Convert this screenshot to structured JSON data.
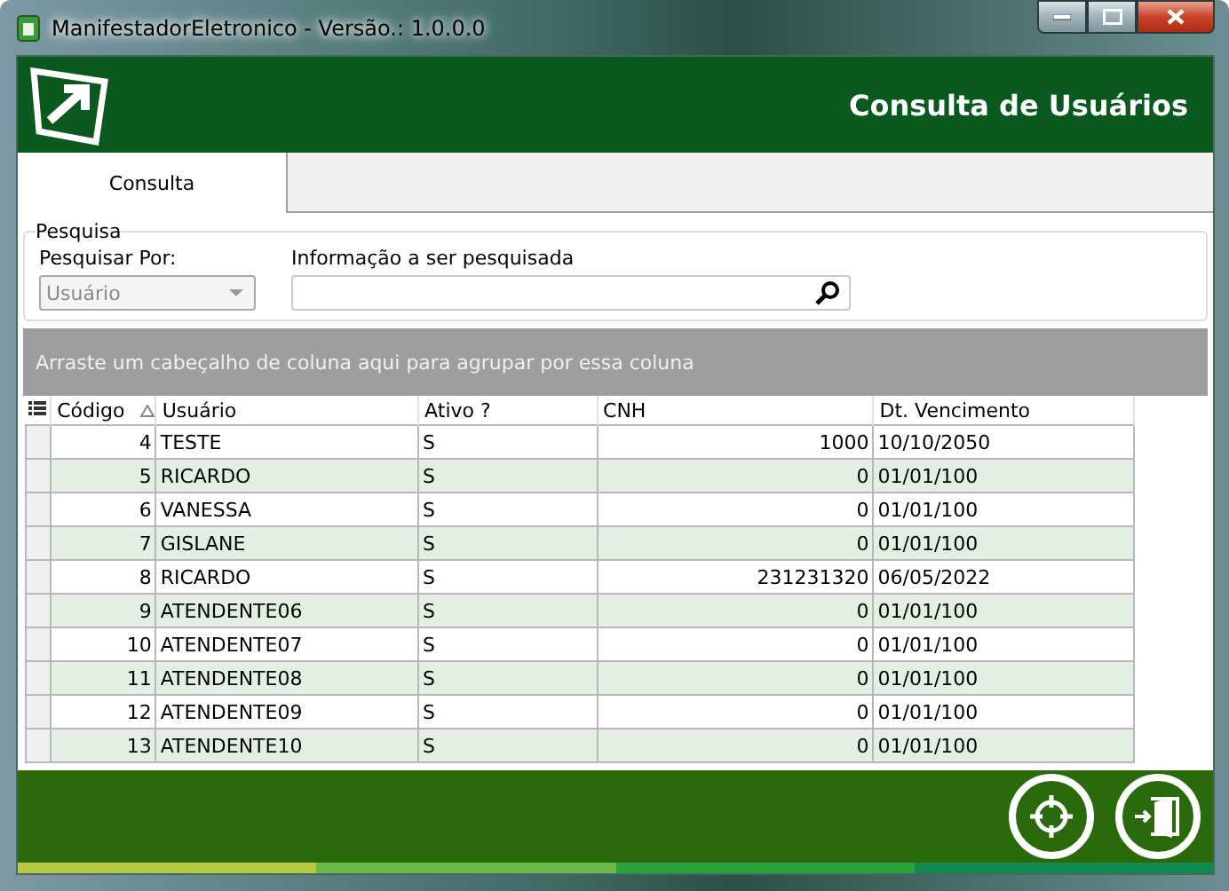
{
  "window": {
    "title": "ManifestadorEletronico - Versão.: 1.0.0.0"
  },
  "header": {
    "title": "Consulta de Usuários"
  },
  "tabs": [
    {
      "label": "Consulta",
      "selected": true
    }
  ],
  "search": {
    "group_title": "Pesquisa",
    "by_label": "Pesquisar Por:",
    "by_value": "Usuário",
    "by_disabled": true,
    "info_label": "Informação a ser pesquisada"
  },
  "group_panel": "Arraste um cabeçalho de coluna aqui para agrupar por essa coluna",
  "table": {
    "columns": [
      "Código",
      "Usuário",
      "Ativo ?",
      "CNH",
      "Dt. Vencimento"
    ],
    "rows": [
      [
        "4",
        "TESTE",
        "S",
        "1000",
        "10/10/2050"
      ],
      [
        "5",
        "RICARDO",
        "S",
        "0",
        "01/01/100"
      ],
      [
        "6",
        "VANESSA",
        "S",
        "0",
        "01/01/100"
      ],
      [
        "7",
        "GISLANE",
        "S",
        "0",
        "01/01/100"
      ],
      [
        "8",
        "RICARDO",
        "S",
        "231231320",
        "06/05/2022"
      ],
      [
        "9",
        "ATENDENTE06",
        "S",
        "0",
        "01/01/100"
      ],
      [
        "10",
        "ATENDENTE07",
        "S",
        "0",
        "01/01/100"
      ],
      [
        "11",
        "ATENDENTE08",
        "S",
        "0",
        "01/01/100"
      ],
      [
        "12",
        "ATENDENTE09",
        "S",
        "0",
        "01/01/100"
      ],
      [
        "13",
        "ATENDENTE10",
        "S",
        "0",
        "01/01/100"
      ]
    ]
  }
}
